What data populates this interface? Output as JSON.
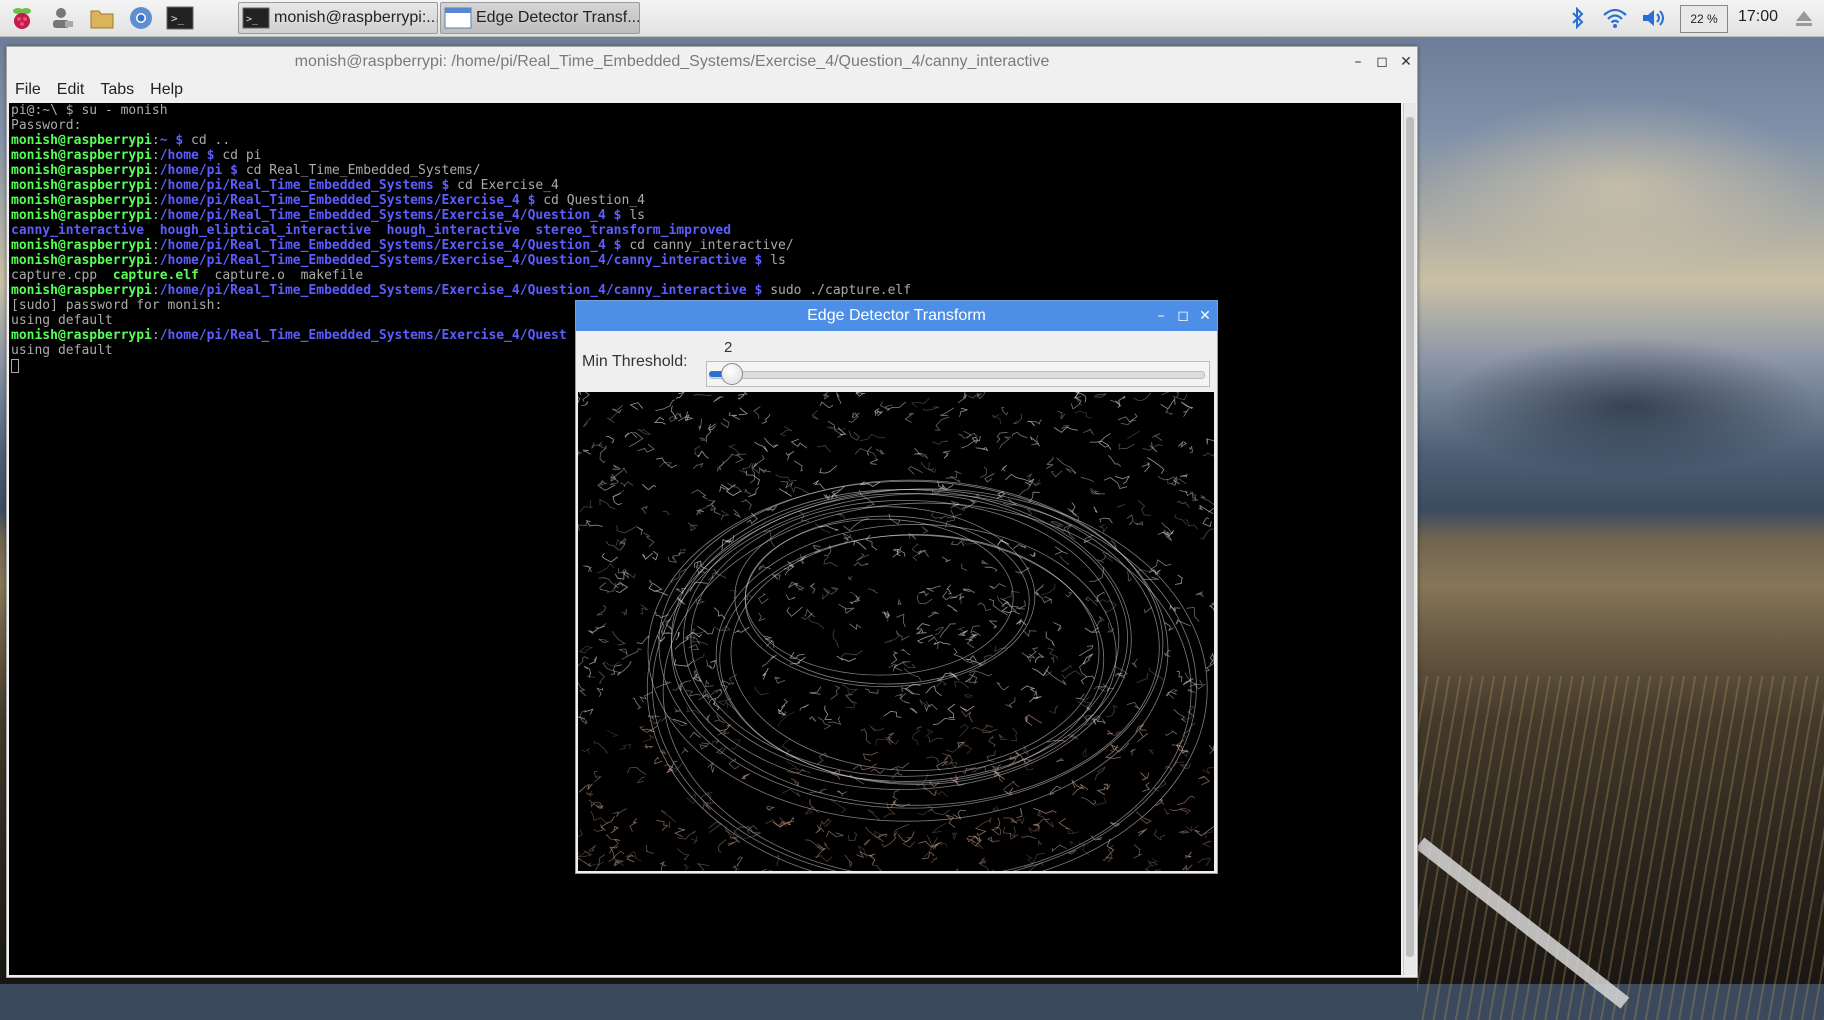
{
  "taskbar": {
    "tasks": [
      {
        "label": "monish@raspberrypi:..."
      },
      {
        "label": "Edge Detector Transf..."
      }
    ],
    "cpu": "22 %",
    "clock": "17:00"
  },
  "terminal": {
    "title": "monish@raspberrypi: /home/pi/Real_Time_Embedded_Systems/Exercise_4/Question_4/canny_interactive",
    "menu": [
      "File",
      "Edit",
      "Tabs",
      "Help"
    ],
    "lines": [
      [
        {
          "t": "pi@:~\\ $ su - monish",
          "c": "plain"
        }
      ],
      [
        {
          "t": "Password:",
          "c": "plain"
        }
      ],
      [
        {
          "t": "monish@raspberrypi",
          "c": "green"
        },
        {
          "t": ":",
          "c": "plain"
        },
        {
          "t": "~ $",
          "c": "blue"
        },
        {
          "t": " cd ..",
          "c": "plain"
        }
      ],
      [
        {
          "t": "monish@raspberrypi",
          "c": "green"
        },
        {
          "t": ":",
          "c": "plain"
        },
        {
          "t": "/home $",
          "c": "blue"
        },
        {
          "t": " cd pi",
          "c": "plain"
        }
      ],
      [
        {
          "t": "monish@raspberrypi",
          "c": "green"
        },
        {
          "t": ":",
          "c": "plain"
        },
        {
          "t": "/home/pi $",
          "c": "blue"
        },
        {
          "t": " cd Real_Time_Embedded_Systems/",
          "c": "plain"
        }
      ],
      [
        {
          "t": "monish@raspberrypi",
          "c": "green"
        },
        {
          "t": ":",
          "c": "plain"
        },
        {
          "t": "/home/pi/Real_Time_Embedded_Systems $",
          "c": "blue"
        },
        {
          "t": " cd Exercise_4",
          "c": "plain"
        }
      ],
      [
        {
          "t": "monish@raspberrypi",
          "c": "green"
        },
        {
          "t": ":",
          "c": "plain"
        },
        {
          "t": "/home/pi/Real_Time_Embedded_Systems/Exercise_4 $",
          "c": "blue"
        },
        {
          "t": " cd Question_4",
          "c": "plain"
        }
      ],
      [
        {
          "t": "monish@raspberrypi",
          "c": "green"
        },
        {
          "t": ":",
          "c": "plain"
        },
        {
          "t": "/home/pi/Real_Time_Embedded_Systems/Exercise_4/Question_4 $",
          "c": "blue"
        },
        {
          "t": " ls",
          "c": "plain"
        }
      ],
      [
        {
          "t": "canny_interactive  hough_eliptical_interactive  hough_interactive  stereo_transform_improved",
          "c": "blue"
        }
      ],
      [
        {
          "t": "monish@raspberrypi",
          "c": "green"
        },
        {
          "t": ":",
          "c": "plain"
        },
        {
          "t": "/home/pi/Real_Time_Embedded_Systems/Exercise_4/Question_4 $",
          "c": "blue"
        },
        {
          "t": " cd canny_interactive/",
          "c": "plain"
        }
      ],
      [
        {
          "t": "monish@raspberrypi",
          "c": "green"
        },
        {
          "t": ":",
          "c": "plain"
        },
        {
          "t": "/home/pi/Real_Time_Embedded_Systems/Exercise_4/Question_4/canny_interactive $",
          "c": "blue"
        },
        {
          "t": " ls",
          "c": "plain"
        }
      ],
      [
        {
          "t": "capture.cpp  ",
          "c": "plain"
        },
        {
          "t": "capture.elf",
          "c": "green"
        },
        {
          "t": "  capture.o  makefile",
          "c": "plain"
        }
      ],
      [
        {
          "t": "monish@raspberrypi",
          "c": "green"
        },
        {
          "t": ":",
          "c": "plain"
        },
        {
          "t": "/home/pi/Real_Time_Embedded_Systems/Exercise_4/Question_4/canny_interactive $",
          "c": "blue"
        },
        {
          "t": " sudo ./capture.elf",
          "c": "plain"
        }
      ],
      [
        {
          "t": "[sudo] password for monish:",
          "c": "plain"
        }
      ],
      [
        {
          "t": "using default",
          "c": "plain"
        }
      ],
      [
        {
          "t": "monish@raspberrypi",
          "c": "green"
        },
        {
          "t": ":",
          "c": "plain"
        },
        {
          "t": "/home/pi/Real_Time_Embedded_Systems/Exercise_4/Quest",
          "c": "blue"
        }
      ],
      [
        {
          "t": "using default",
          "c": "plain"
        }
      ]
    ]
  },
  "edge_window": {
    "title": "Edge Detector Transform",
    "slider_label": "Min Threshold:",
    "slider_value": "2",
    "slider_fraction": 0.02
  }
}
